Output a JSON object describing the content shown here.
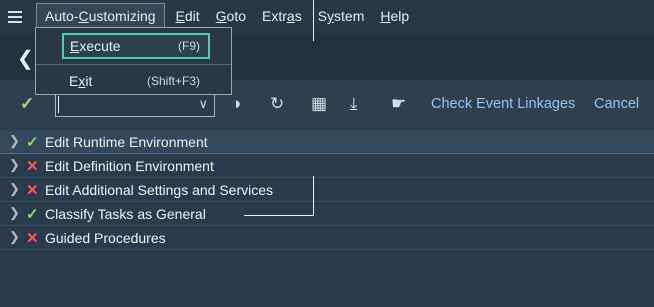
{
  "menubar": {
    "items": [
      {
        "pre": "Auto-",
        "ul": "C",
        "post": "ustomizing"
      },
      {
        "pre": "",
        "ul": "E",
        "post": "dit"
      },
      {
        "pre": "",
        "ul": "G",
        "post": "oto"
      },
      {
        "pre": "Extr",
        "ul": "a",
        "post": "s"
      },
      {
        "pre": "S",
        "ul": "y",
        "post": "stem"
      },
      {
        "pre": "",
        "ul": "H",
        "post": "elp"
      }
    ]
  },
  "dropdown": {
    "execute": {
      "ul": "E",
      "rest": "xecute",
      "shortcut": "(F9)"
    },
    "exit": {
      "pre": "E",
      "ul": "x",
      "post": "it",
      "shortcut": "(Shift+F3)"
    }
  },
  "titlebar": {
    "back_icon": "chevron-left-icon"
  },
  "toolbar": {
    "combo_value": "",
    "check_events_label": "Check Event Linkages",
    "cancel_label": "Cancel"
  },
  "list": {
    "rows": [
      {
        "status": "ok",
        "label": "Edit Runtime Environment"
      },
      {
        "status": "error",
        "label": "Edit Definition Environment"
      },
      {
        "status": "error",
        "label": "Edit Additional Settings and Services"
      },
      {
        "status": "ok",
        "label": "Classify Tasks as General"
      },
      {
        "status": "error",
        "label": "Guided Procedures"
      }
    ]
  },
  "colors": {
    "accent_link": "#8fc6f5",
    "ok": "#8ad96a",
    "error": "#ff5a5a",
    "focus": "#4ccfa8"
  }
}
